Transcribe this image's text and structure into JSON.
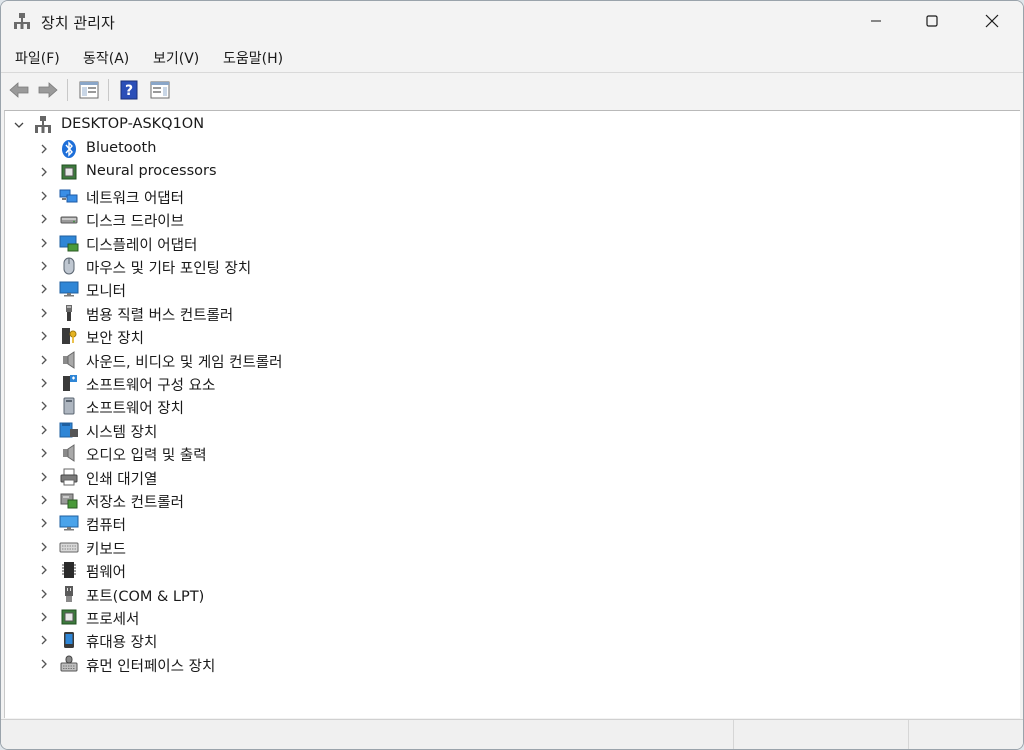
{
  "window": {
    "title": "장치 관리자"
  },
  "menu": [
    {
      "label": "파일(F)"
    },
    {
      "label": "동작(A)"
    },
    {
      "label": "보기(V)"
    },
    {
      "label": "도움말(H)"
    }
  ],
  "tree": {
    "root": "DESKTOP-ASKQ1ON",
    "items": [
      {
        "label": "Bluetooth",
        "icon": "bluetooth-icon"
      },
      {
        "label": "Neural processors",
        "icon": "chip-icon"
      },
      {
        "label": "네트워크 어댑터",
        "icon": "network-adapter-icon"
      },
      {
        "label": "디스크 드라이브",
        "icon": "disk-drive-icon"
      },
      {
        "label": "디스플레이 어댑터",
        "icon": "display-adapter-icon"
      },
      {
        "label": "마우스 및 기타 포인팅 장치",
        "icon": "mouse-icon"
      },
      {
        "label": "모니터",
        "icon": "monitor-icon"
      },
      {
        "label": "범용 직렬 버스 컨트롤러",
        "icon": "usb-icon"
      },
      {
        "label": "보안 장치",
        "icon": "security-key-icon"
      },
      {
        "label": "사운드, 비디오 및 게임 컨트롤러",
        "icon": "speaker-icon"
      },
      {
        "label": "소프트웨어 구성 요소",
        "icon": "software-component-icon"
      },
      {
        "label": "소프트웨어 장치",
        "icon": "software-device-icon"
      },
      {
        "label": "시스템 장치",
        "icon": "system-device-icon"
      },
      {
        "label": "오디오 입력 및 출력",
        "icon": "audio-io-icon"
      },
      {
        "label": "인쇄 대기열",
        "icon": "printer-icon"
      },
      {
        "label": "저장소 컨트롤러",
        "icon": "storage-controller-icon"
      },
      {
        "label": "컴퓨터",
        "icon": "computer-icon"
      },
      {
        "label": "키보드",
        "icon": "keyboard-icon"
      },
      {
        "label": "펌웨어",
        "icon": "firmware-icon"
      },
      {
        "label": "포트(COM & LPT)",
        "icon": "port-icon"
      },
      {
        "label": "프로세서",
        "icon": "processor-icon"
      },
      {
        "label": "휴대용 장치",
        "icon": "portable-device-icon"
      },
      {
        "label": "휴먼 인터페이스 장치",
        "icon": "hid-icon"
      }
    ]
  },
  "colors": {
    "accent": "#0078d4",
    "window_bg": "#f3f3f3",
    "tree_bg": "#ffffff"
  }
}
